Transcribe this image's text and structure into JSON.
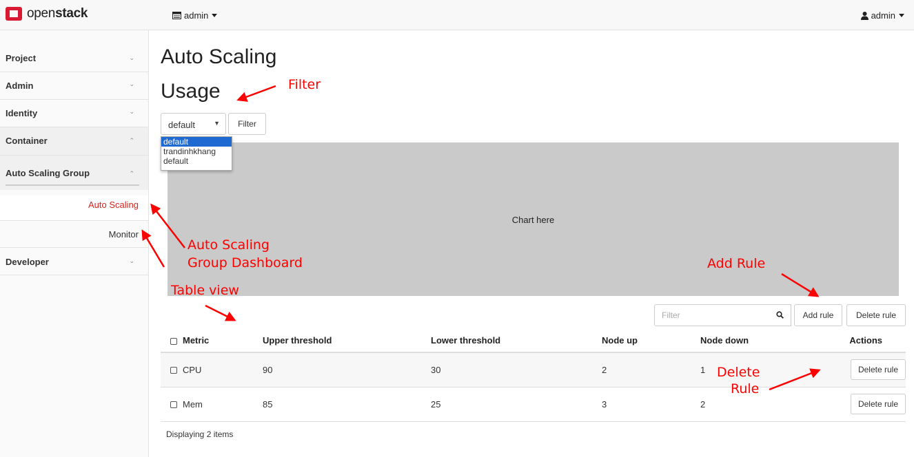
{
  "topbar": {
    "logo_text_a": "open",
    "logo_text_b": "stack",
    "project_label": "admin",
    "user_label": "admin"
  },
  "sidebar": {
    "items": [
      {
        "label": "Project"
      },
      {
        "label": "Admin"
      },
      {
        "label": "Identity"
      },
      {
        "label": "Container"
      },
      {
        "label": "Auto Scaling Group"
      },
      {
        "label": "Developer"
      }
    ],
    "subitems": [
      {
        "label": "Auto Scaling",
        "active": true
      },
      {
        "label": "Monitor",
        "active": false
      }
    ]
  },
  "main": {
    "title": "Auto Scaling",
    "subtitle": "Usage",
    "select_value": "default",
    "filter_button": "Filter",
    "dropdown_options": [
      "default",
      "trandinhkhang",
      "default"
    ],
    "chart_placeholder": "Chart here",
    "table_filter_placeholder": "Filter",
    "add_rule_button": "Add rule",
    "delete_rule_button": "Delete rule",
    "table": {
      "headers": [
        "Metric",
        "Upper threshold",
        "Lower threshold",
        "Node up",
        "Node down",
        "Actions"
      ],
      "rows": [
        {
          "metric": "CPU",
          "upper": "90",
          "lower": "30",
          "node_up": "2",
          "node_down": "1",
          "action": "Delete rule"
        },
        {
          "metric": "Mem",
          "upper": "85",
          "lower": "25",
          "node_up": "3",
          "node_down": "2",
          "action": "Delete rule"
        }
      ]
    },
    "footer": "Displaying 2 items"
  },
  "annotations": {
    "filter": "Filter",
    "asg_line1": "Auto Scaling",
    "asg_line2": "Group Dashboard",
    "add_rule": "Add Rule",
    "table_view": "Table view",
    "delete_line1": "Delete",
    "delete_line2": "Rule",
    "color": "#ff0000"
  },
  "colors": {
    "brand": "#da1a32",
    "active_link": "#d7231b",
    "dropdown_highlight": "#1e69d2",
    "chart_bg": "#cacaca"
  }
}
